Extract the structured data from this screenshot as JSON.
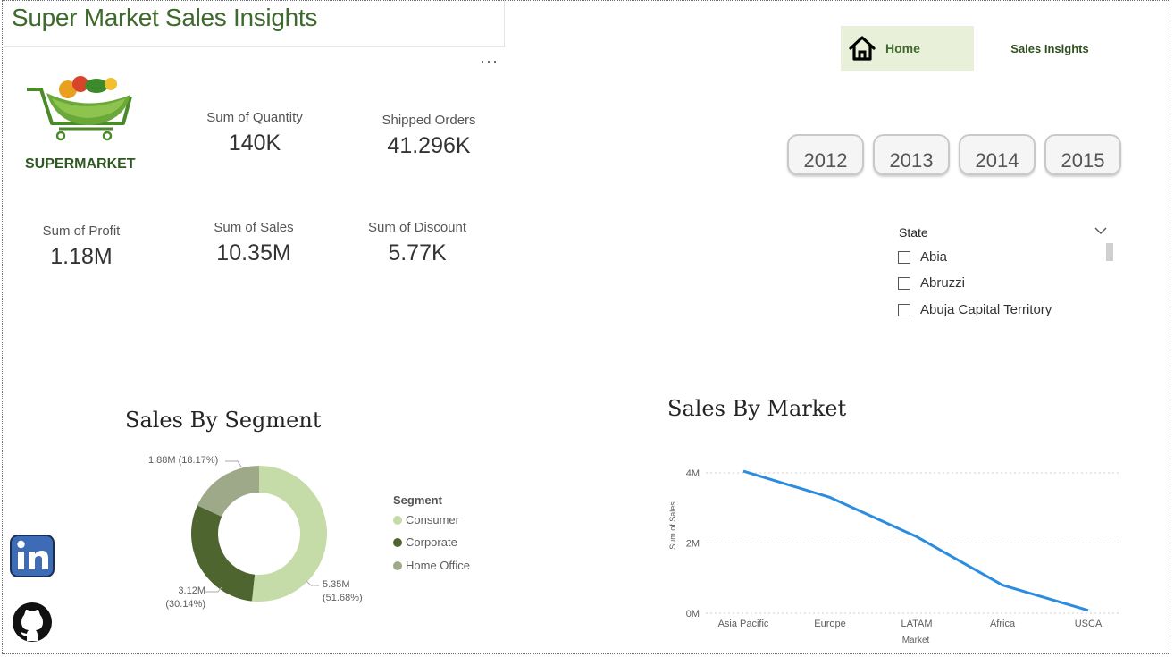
{
  "header": {
    "title": "Super Market Sales Insights"
  },
  "nav": {
    "home_label": "Home",
    "sales_label": "Sales Insights"
  },
  "logo": {
    "text": "SUPERMARKET"
  },
  "kpis": {
    "quantity": {
      "label": "Sum of Quantity",
      "value": "140K"
    },
    "shipped": {
      "label": "Shipped Orders",
      "value": "41.296K"
    },
    "profit": {
      "label": "Sum of Profit",
      "value": "1.18M"
    },
    "sales": {
      "label": "Sum of Sales",
      "value": "10.35M"
    },
    "discount": {
      "label": "Sum of Discount",
      "value": "5.77K"
    }
  },
  "years": [
    "2012",
    "2013",
    "2014",
    "2015"
  ],
  "state_slicer": {
    "title": "State",
    "options": [
      "Abia",
      "Abruzzi",
      "Abuja Capital Territory"
    ]
  },
  "colors": {
    "accent_green": "#3e6a2d",
    "consumer": "#c5dba8",
    "corporate": "#4e6530",
    "home_office": "#9ea98a",
    "line": "#2b8ce0"
  },
  "chart_data": [
    {
      "type": "pie",
      "title": "Sales By Segment",
      "legend_title": "Segment",
      "legend_position": "right",
      "categories": [
        "Consumer",
        "Corporate",
        "Home Office"
      ],
      "values": [
        5.35,
        3.12,
        1.88
      ],
      "unit": "M",
      "percentages": [
        51.68,
        30.14,
        18.17
      ],
      "labels": [
        "5.35M (51.68%)",
        "3.12M (30.14%)",
        "1.88M (18.17%)"
      ]
    },
    {
      "type": "line",
      "title": "Sales By Market",
      "xlabel": "Market",
      "ylabel": "Sum of Sales",
      "categories": [
        "Asia Pacific",
        "Europe",
        "LATAM",
        "Africa",
        "USCA"
      ],
      "values": [
        4050000,
        3300000,
        2180000,
        800000,
        80000
      ],
      "yticks": [
        "0M",
        "2M",
        "4M"
      ],
      "ylim": [
        0,
        4000000
      ],
      "grid": true
    }
  ]
}
